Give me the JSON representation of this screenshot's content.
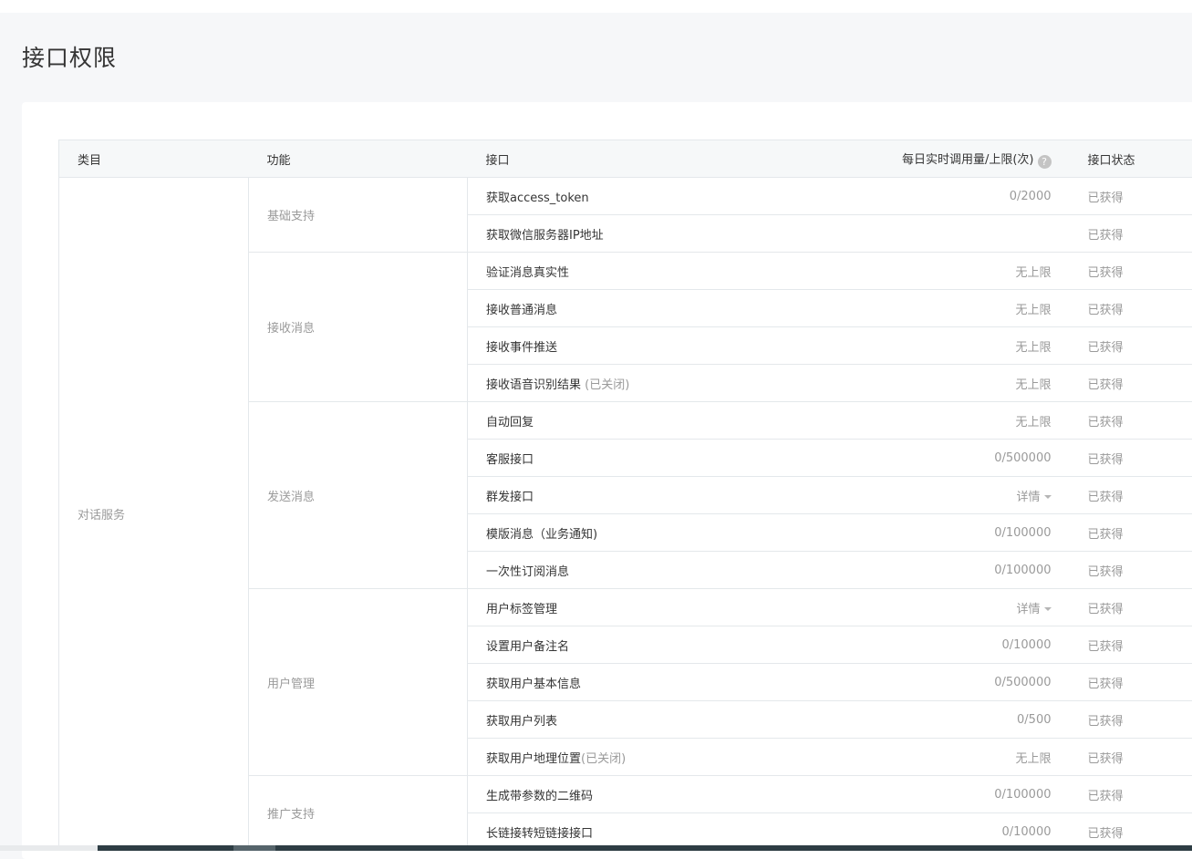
{
  "page": {
    "title": "接口权限"
  },
  "table": {
    "headers": {
      "category": "类目",
      "function": "功能",
      "api": "接口",
      "quota": "每日实时调用量/上限(次)",
      "status": "接口状态"
    },
    "help_icon": "question-circle-icon",
    "category": "对话服务",
    "groups": [
      {
        "function": "基础支持",
        "rows": [
          {
            "api": "获取access_token",
            "quota": "0/2000",
            "status": "已获得"
          },
          {
            "api": "获取微信服务器IP地址",
            "quota": "",
            "status": "已获得"
          }
        ]
      },
      {
        "function": "接收消息",
        "rows": [
          {
            "api": "验证消息真实性",
            "quota": "无上限",
            "status": "已获得"
          },
          {
            "api": "接收普通消息",
            "quota": "无上限",
            "status": "已获得"
          },
          {
            "api": "接收事件推送",
            "quota": "无上限",
            "status": "已获得"
          },
          {
            "api": "接收语音识别结果",
            "api_note": " (已关闭)",
            "quota": "无上限",
            "status": "已获得"
          }
        ]
      },
      {
        "function": "发送消息",
        "rows": [
          {
            "api": "自动回复",
            "quota": "无上限",
            "status": "已获得"
          },
          {
            "api": "客服接口",
            "quota": "0/500000",
            "status": "已获得"
          },
          {
            "api": "群发接口",
            "quota": "详情",
            "quota_dropdown": true,
            "status": "已获得"
          },
          {
            "api": "模版消息（业务通知)",
            "quota": "0/100000",
            "status": "已获得"
          },
          {
            "api": "一次性订阅消息",
            "quota": "0/100000",
            "status": "已获得"
          }
        ]
      },
      {
        "function": "用户管理",
        "rows": [
          {
            "api": "用户标签管理",
            "quota": "详情",
            "quota_dropdown": true,
            "status": "已获得"
          },
          {
            "api": "设置用户备注名",
            "quota": "0/10000",
            "status": "已获得"
          },
          {
            "api": "获取用户基本信息",
            "quota": "0/500000",
            "status": "已获得"
          },
          {
            "api": "获取用户列表",
            "quota": "0/500",
            "status": "已获得"
          },
          {
            "api": "获取用户地理位置",
            "api_note": "(已关闭)",
            "quota": "无上限",
            "status": "已获得"
          }
        ]
      },
      {
        "function": "推广支持",
        "rows": [
          {
            "api": "生成带参数的二维码",
            "quota": "0/100000",
            "status": "已获得"
          },
          {
            "api": "长链接转短链接接口",
            "quota": "0/10000",
            "status": "已获得"
          }
        ]
      }
    ]
  }
}
